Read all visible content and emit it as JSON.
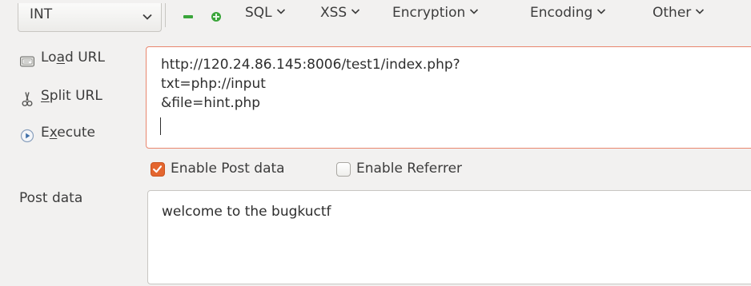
{
  "toolbar": {
    "select_value": "INT",
    "minus_icon": "minus-icon",
    "plus_icon": "plus-icon",
    "menus": [
      "SQL",
      "XSS",
      "Encryption",
      "Encoding",
      "Other"
    ],
    "accent_green": "#3aa53a"
  },
  "actions": {
    "load_url": {
      "pre": "Lo",
      "key": "a",
      "post": "d URL",
      "icon": "load-url-icon"
    },
    "split_url": {
      "pre": "",
      "key": "S",
      "post": "plit URL",
      "icon": "scissors-icon"
    },
    "execute": {
      "pre": "E",
      "key": "x",
      "post": "ecute",
      "icon": "play-icon"
    }
  },
  "url_field": {
    "value": "http://120.24.86.145:8006/test1/index.php?\ntxt=php://input\n&file=hint.php"
  },
  "options": {
    "enable_post": {
      "label": "Enable Post data",
      "checked": true
    },
    "enable_referrer": {
      "label": "Enable Referrer",
      "checked": false
    },
    "checkbox_color": "#e4662f"
  },
  "post": {
    "label": "Post data",
    "value": "welcome to the bugkuctf"
  }
}
